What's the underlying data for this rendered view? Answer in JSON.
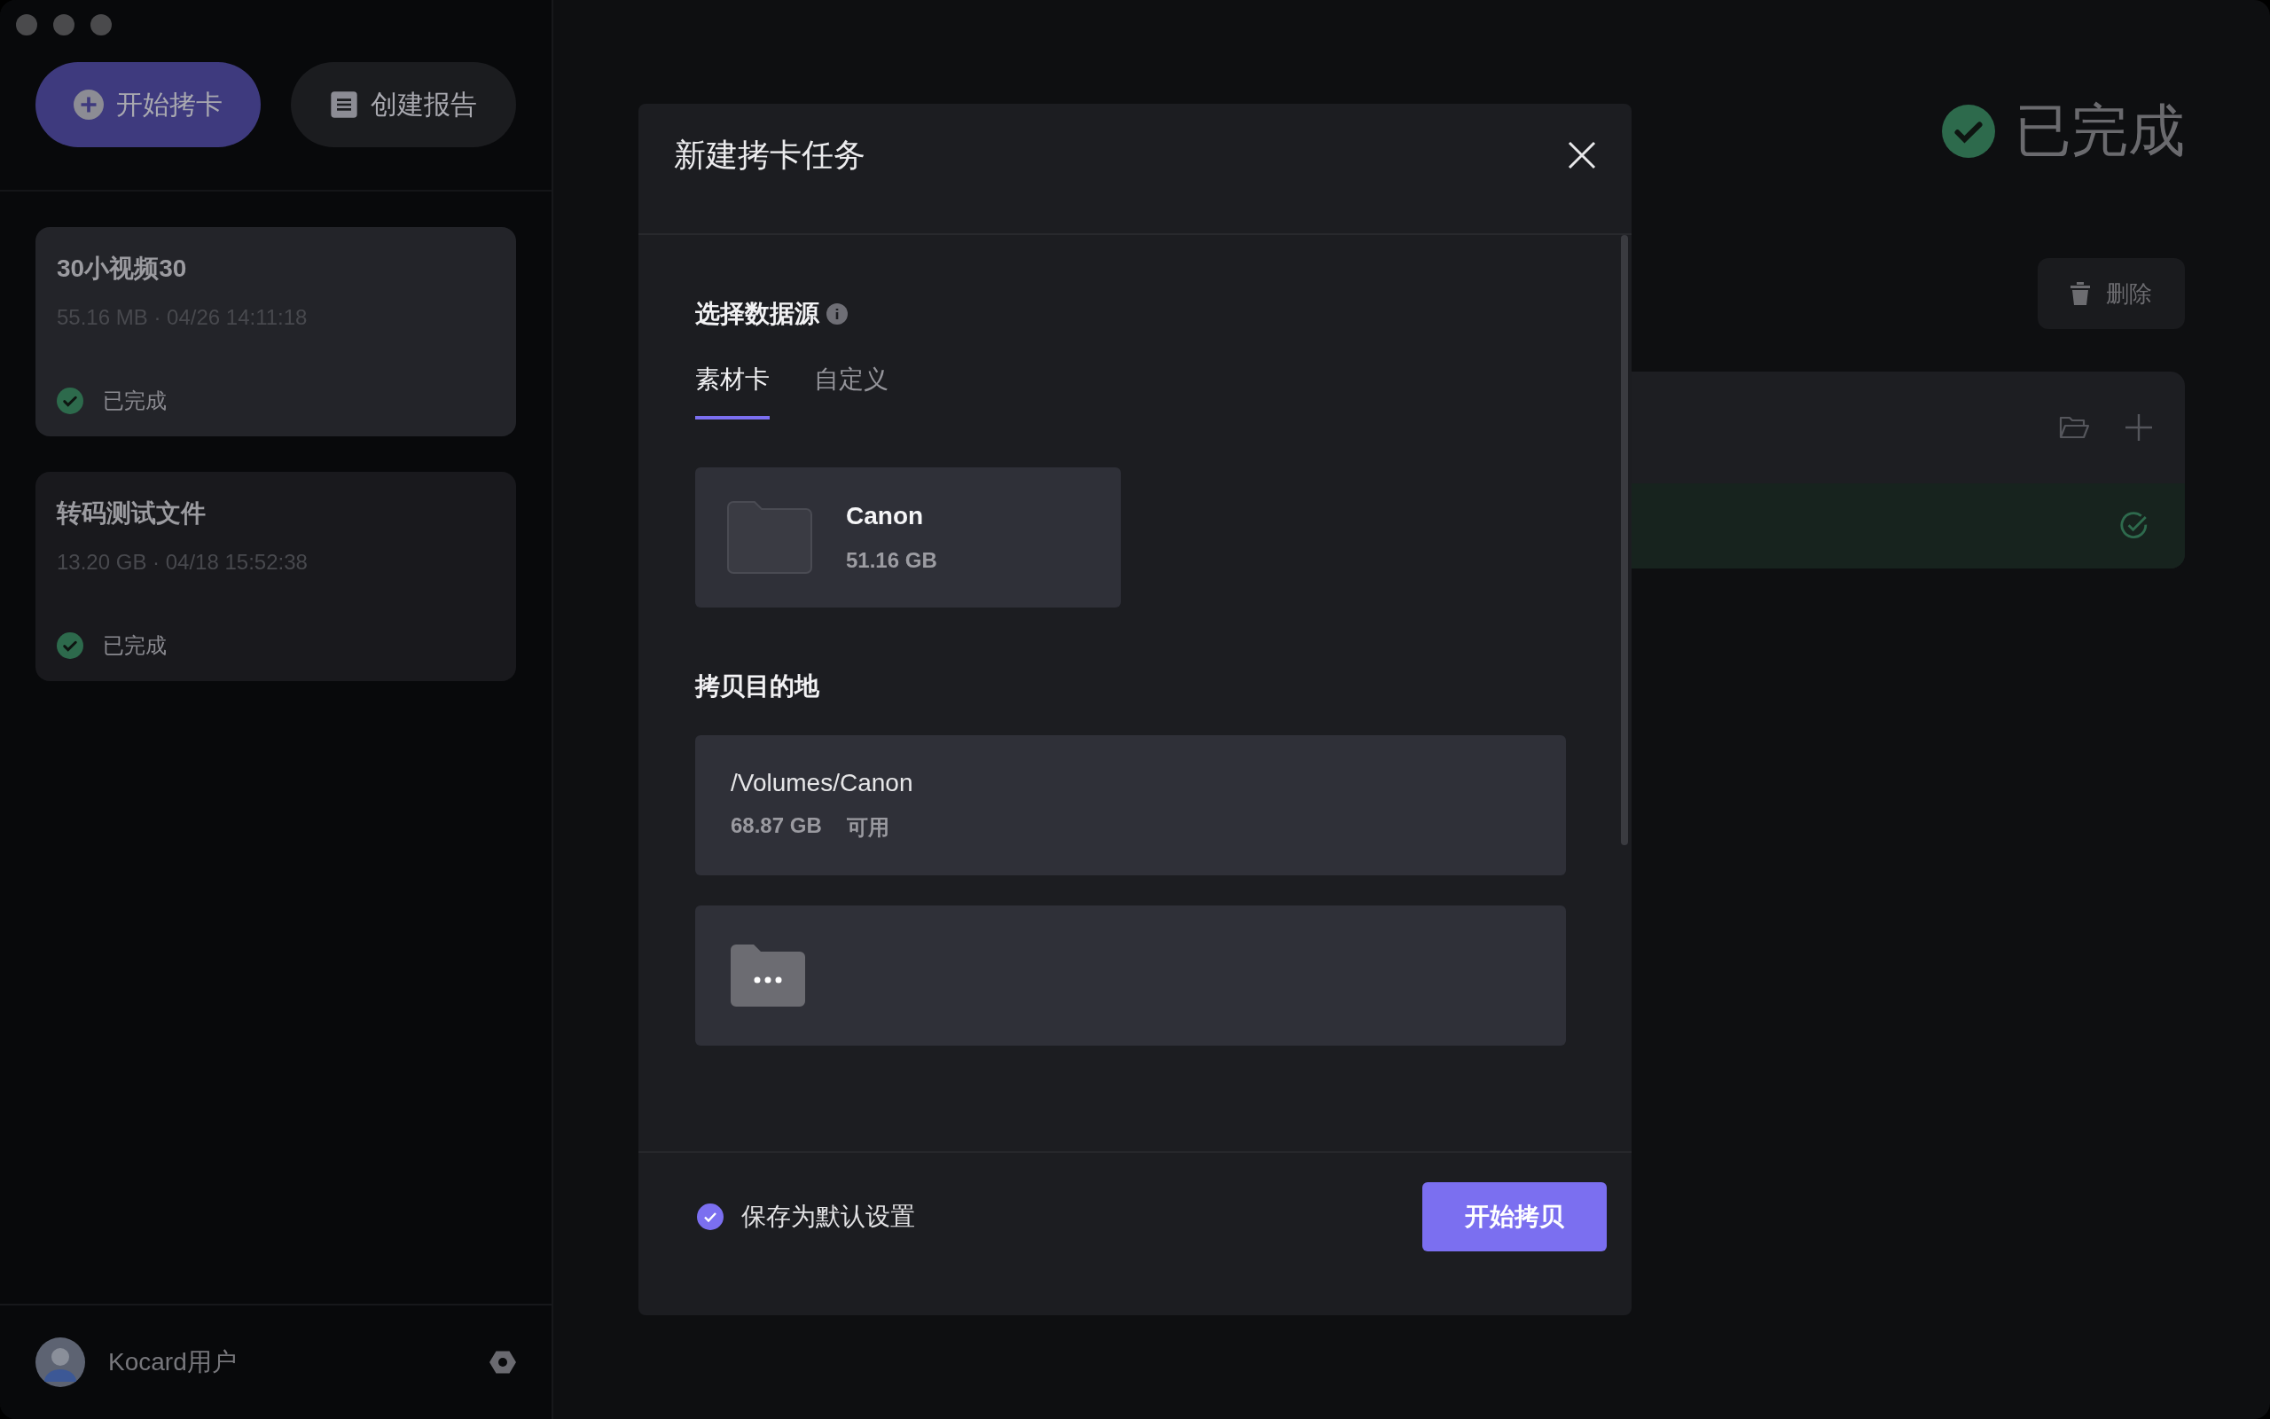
{
  "sidebar": {
    "actions": [
      {
        "label": "开始拷卡",
        "kind": "primary"
      },
      {
        "label": "创建报告",
        "kind": "secondary"
      }
    ],
    "tasks": [
      {
        "title": "30小视频30",
        "meta": "55.16 MB · 04/26 14:11:18",
        "status": "已完成",
        "selected": true
      },
      {
        "title": "转码测试文件",
        "meta": "13.20 GB · 04/18 15:52:38",
        "status": "已完成",
        "selected": false
      }
    ],
    "user": {
      "name": "Kocard用户"
    }
  },
  "main": {
    "status": "已完成",
    "delete_button": "删除"
  },
  "dialog": {
    "title": "新建拷卡任务",
    "source_label": "选择数据源",
    "tabs": [
      {
        "label": "素材卡",
        "selected": true
      },
      {
        "label": "自定义",
        "selected": false
      }
    ],
    "sources": [
      {
        "name": "Canon",
        "size": "51.16 GB"
      }
    ],
    "destination_label": "拷贝目的地",
    "destinations": [
      {
        "kind": "volume",
        "path": "/Volumes/Canon",
        "free": "68.87 GB",
        "free_label": "可用"
      },
      {
        "kind": "browse"
      }
    ],
    "save_default": {
      "label": "保存为默认设置",
      "checked": true
    },
    "confirm_button": "开始拷贝"
  }
}
